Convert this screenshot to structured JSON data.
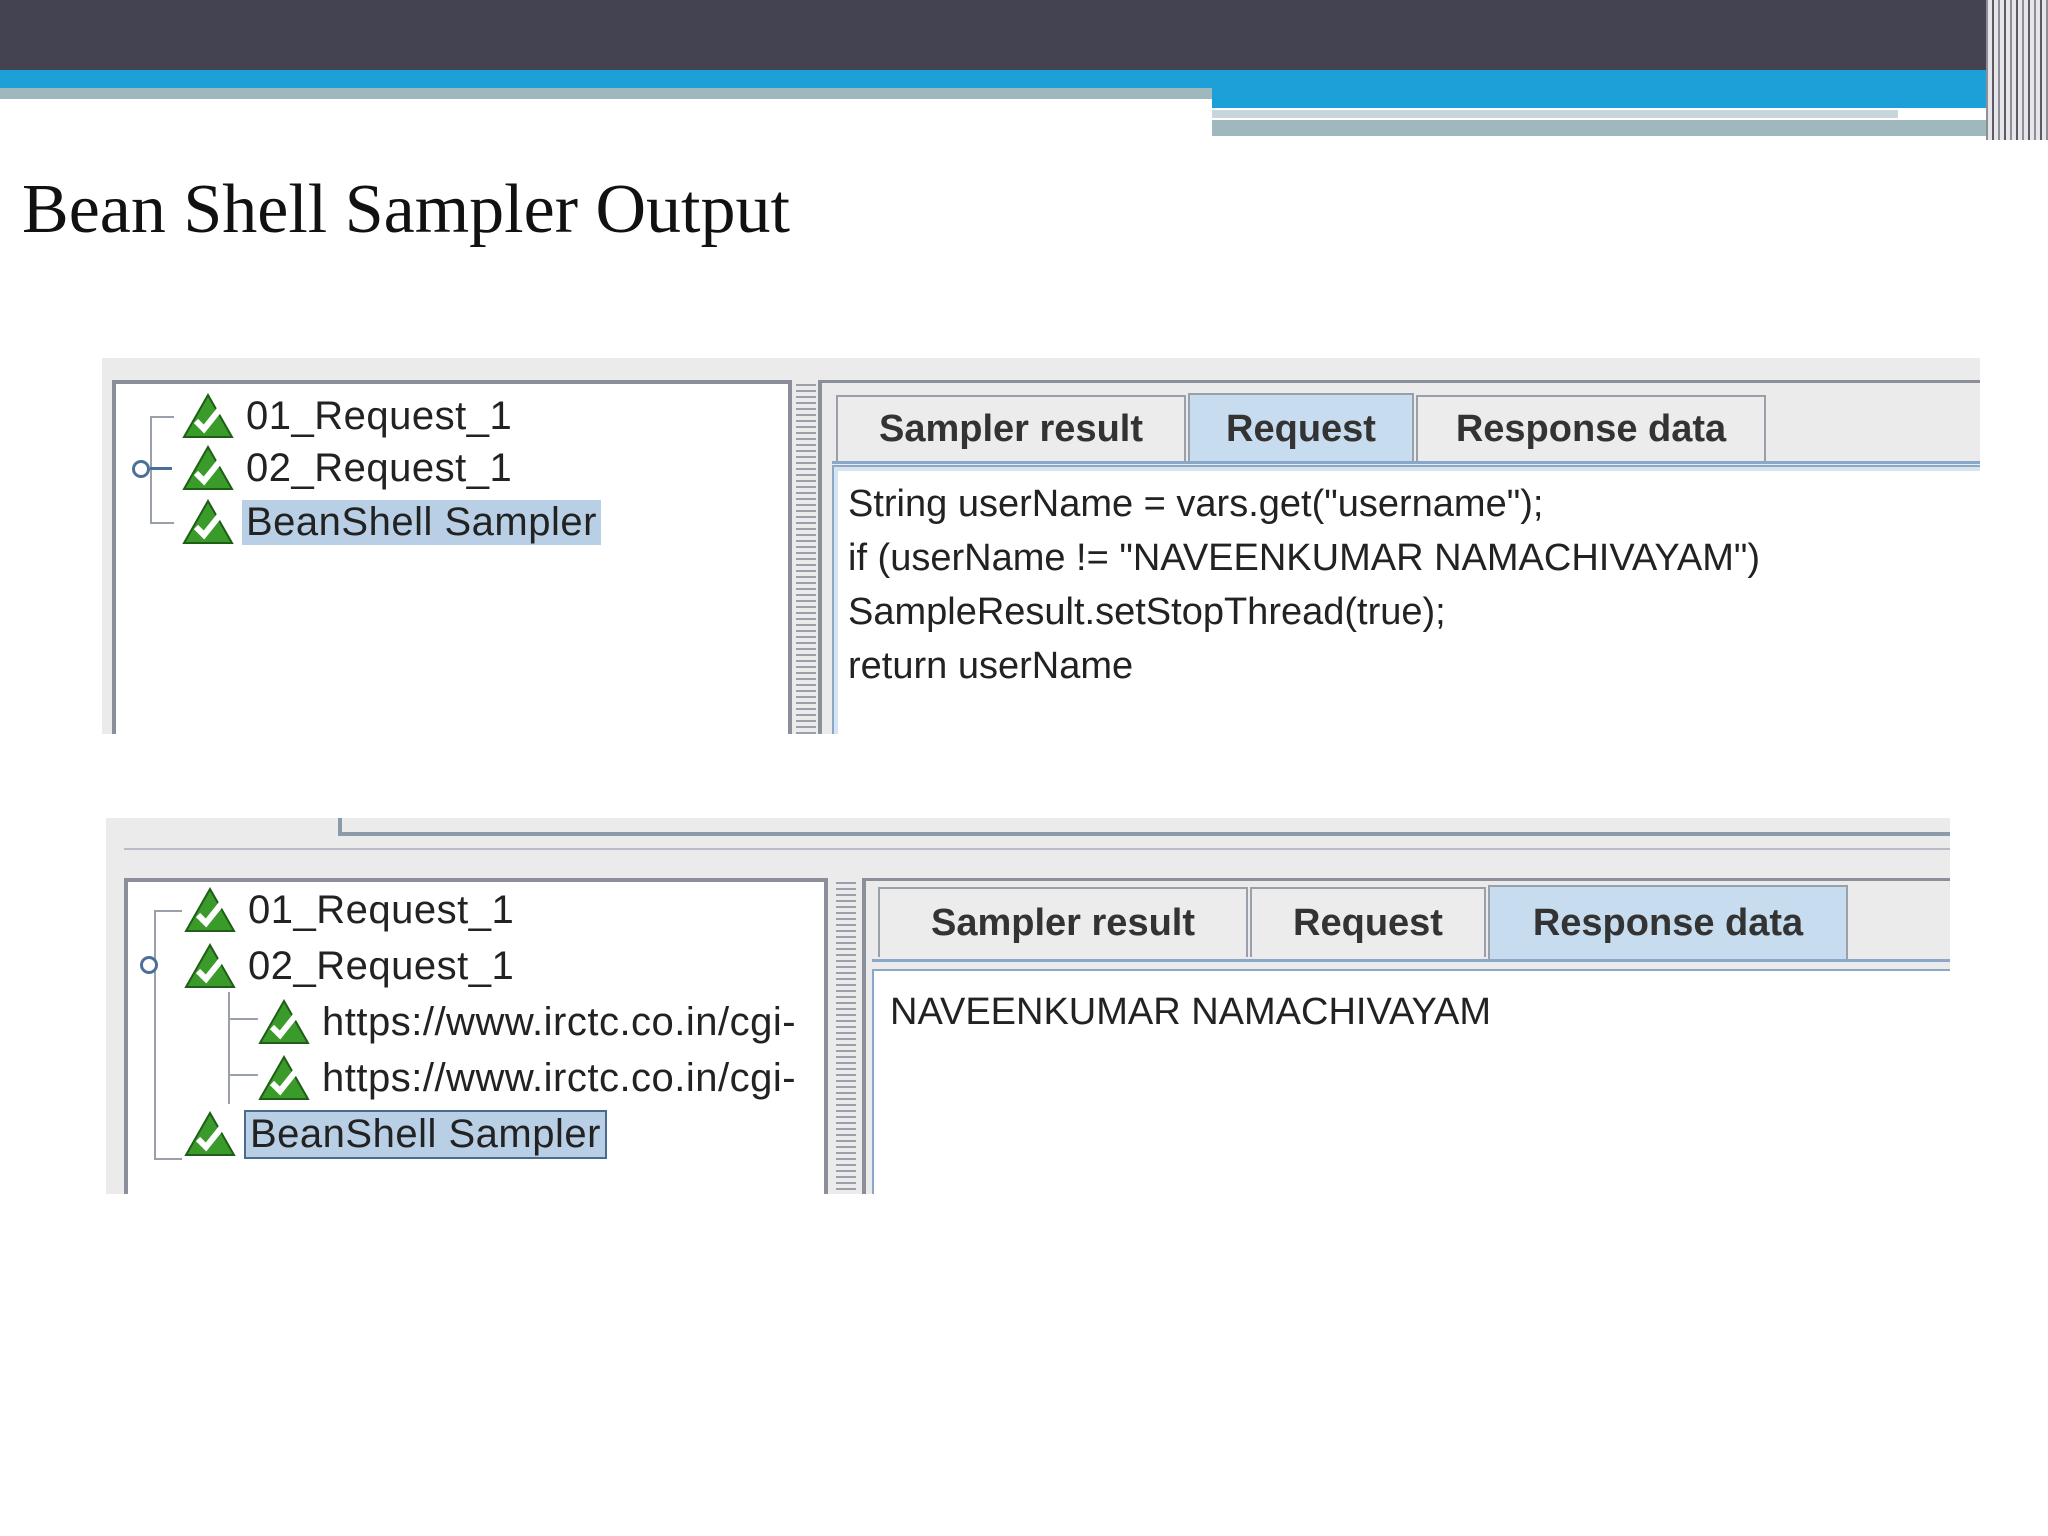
{
  "slide": {
    "title": "Bean Shell Sampler Output"
  },
  "colors": {
    "header_dark": "#434352",
    "header_blue": "#1d9fd8",
    "header_teal": "#9eb8bd",
    "selection": "#b8cfe5",
    "active_tab": "#c7dcef",
    "success_icon": "#3a9a2a"
  },
  "screenshot1": {
    "tree": [
      {
        "label": "01_Request_1",
        "icon": "success-triangle-icon"
      },
      {
        "label": "02_Request_1",
        "icon": "success-triangle-icon"
      },
      {
        "label": "BeanShell Sampler",
        "icon": "success-triangle-icon",
        "selected": true
      }
    ],
    "tabs": [
      {
        "label": "Sampler result"
      },
      {
        "label": "Request",
        "active": true
      },
      {
        "label": "Response data"
      }
    ],
    "code_lines": [
      "String userName = vars.get(\"username\");",
      "if (userName != \"NAVEENKUMAR NAMACHIVAYAM\")",
      "SampleResult.setStopThread(true);",
      "return userName"
    ]
  },
  "screenshot2": {
    "tree": [
      {
        "label": "01_Request_1",
        "icon": "success-triangle-icon"
      },
      {
        "label": "02_Request_1",
        "icon": "success-triangle-icon"
      },
      {
        "label": "https://www.irctc.co.in/cgi-",
        "icon": "success-triangle-icon"
      },
      {
        "label": "https://www.irctc.co.in/cgi-",
        "icon": "success-triangle-icon"
      },
      {
        "label": "BeanShell Sampler",
        "icon": "success-triangle-icon",
        "selected": true
      }
    ],
    "tabs": [
      {
        "label": "Sampler result"
      },
      {
        "label": "Request"
      },
      {
        "label": "Response data",
        "active": true
      }
    ],
    "response": "NAVEENKUMAR NAMACHIVAYAM"
  }
}
